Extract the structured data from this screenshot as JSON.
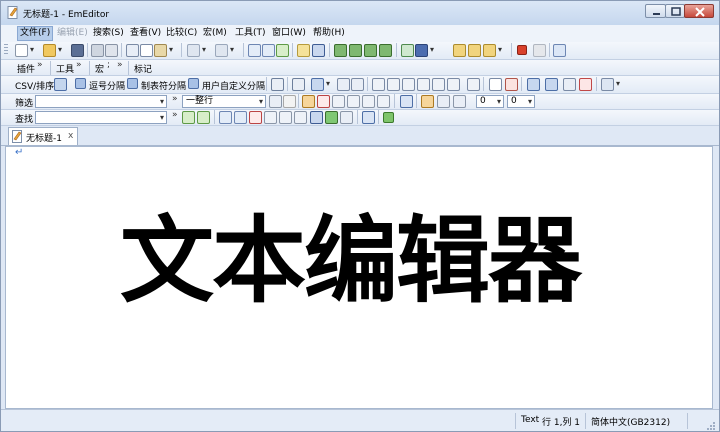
{
  "window": {
    "title": "无标题-1 - EmEditor"
  },
  "menu": {
    "items": [
      {
        "label": "文件(F)",
        "state": "normal"
      },
      {
        "label": "编辑(E)",
        "state": "disabled"
      },
      {
        "label": "搜索(S)",
        "state": "normal"
      },
      {
        "label": "查看(V)",
        "state": "normal"
      },
      {
        "label": "比较(C)",
        "state": "normal"
      },
      {
        "label": "宏(M)",
        "state": "normal"
      },
      {
        "label": "工具(T)",
        "state": "normal"
      },
      {
        "label": "窗口(W)",
        "state": "normal"
      },
      {
        "label": "帮助(H)",
        "state": "normal"
      }
    ]
  },
  "toolbars": {
    "plugins": "插件",
    "tools": "工具",
    "macros": "宏",
    "markers": "标记",
    "csv_sort": "CSV/排序",
    "comma_sep": "逗号分隔",
    "tab_sep": "制表符分隔",
    "user_sep": "用户自定义分隔"
  },
  "filter": {
    "label": "筛选",
    "value": "",
    "scope": "一整行",
    "num1": "0",
    "num2": "0"
  },
  "find": {
    "label": "查找",
    "value": ""
  },
  "tabs": [
    {
      "label": "无标题-1",
      "close": "x"
    }
  ],
  "editor": {
    "content": "文本编辑器",
    "eol_marker": "↵"
  },
  "status": {
    "mode": "Text",
    "position": "行 1,列 1",
    "encoding": "简体中文(GB2312)"
  },
  "colors": {
    "accent": "#3a72c8",
    "toolbar_bg": "#e3ebf6",
    "close_button": "#c6483b"
  }
}
